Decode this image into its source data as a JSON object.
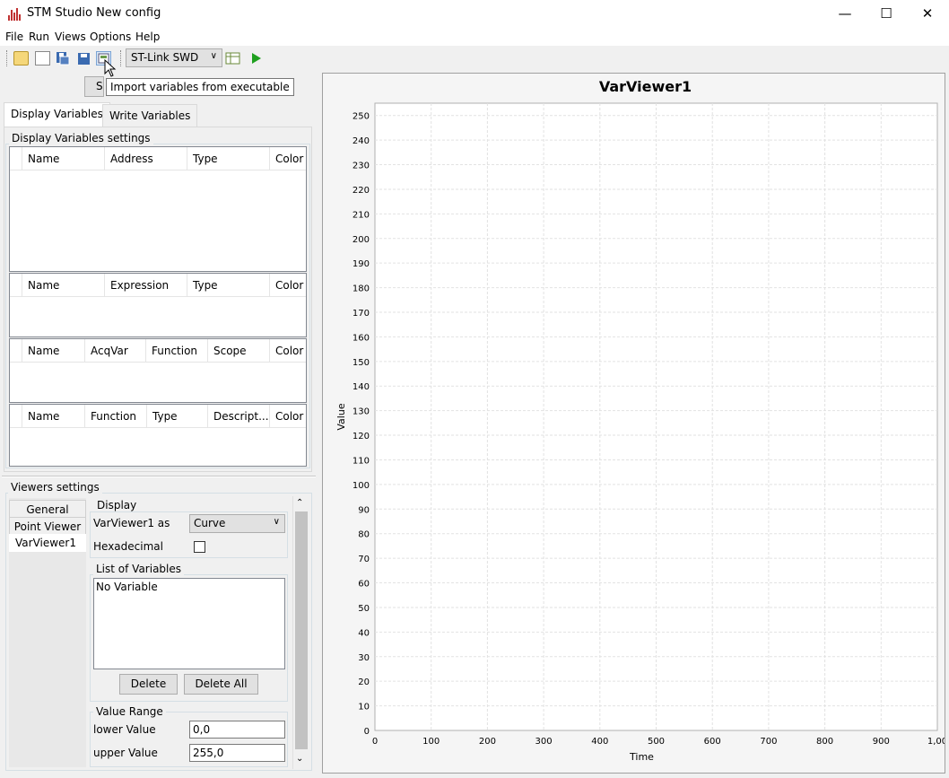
{
  "window": {
    "title": "STM Studio New config",
    "minimize": "—",
    "maximize": "☐",
    "close": "✕"
  },
  "menu": [
    "File",
    "Run",
    "Views",
    "Options",
    "Help"
  ],
  "toolbar": {
    "connection": "ST-Link SWD",
    "tooltip": "Import variables from executable",
    "hidden_button_label": "S"
  },
  "tabs": {
    "display": "Display Variables",
    "write": "Write Variables"
  },
  "display_settings": {
    "title": "Display Variables settings",
    "tables": [
      [
        "Name",
        "Address",
        "Type",
        "Color"
      ],
      [
        "Name",
        "Expression",
        "Type",
        "Color"
      ],
      [
        "Name",
        "AcqVar",
        "Function",
        "Scope",
        "Color"
      ],
      [
        "Name",
        "Function",
        "Type",
        "Descript...",
        "Color"
      ]
    ]
  },
  "viewers": {
    "title": "Viewers settings",
    "list": [
      "General",
      "Point Viewer",
      "VarViewer1"
    ],
    "display_group": "Display",
    "viewer_as_label": "VarViewer1 as",
    "viewer_as_value": "Curve",
    "hex_label": "Hexadecimal",
    "list_group": "List of Variables",
    "list_empty": "No Variable",
    "delete": "Delete",
    "delete_all": "Delete All",
    "range_group": "Value Range",
    "lower_label": "lower Value",
    "lower_value": "0,0",
    "upper_label": "upper Value",
    "upper_value": "255,0"
  },
  "chart_data": {
    "type": "line",
    "title": "VarViewer1",
    "xlabel": "Time",
    "ylabel": "Value",
    "xlim": [
      0,
      1000
    ],
    "ylim": [
      0,
      255
    ],
    "x_ticks": [
      "0",
      "100",
      "200",
      "300",
      "400",
      "500",
      "600",
      "700",
      "800",
      "900",
      "1,00"
    ],
    "y_ticks": [
      "0",
      "10",
      "20",
      "30",
      "40",
      "50",
      "60",
      "70",
      "80",
      "90",
      "100",
      "110",
      "120",
      "130",
      "140",
      "150",
      "160",
      "170",
      "180",
      "190",
      "200",
      "210",
      "220",
      "230",
      "240",
      "250"
    ],
    "grid": true,
    "series": []
  }
}
